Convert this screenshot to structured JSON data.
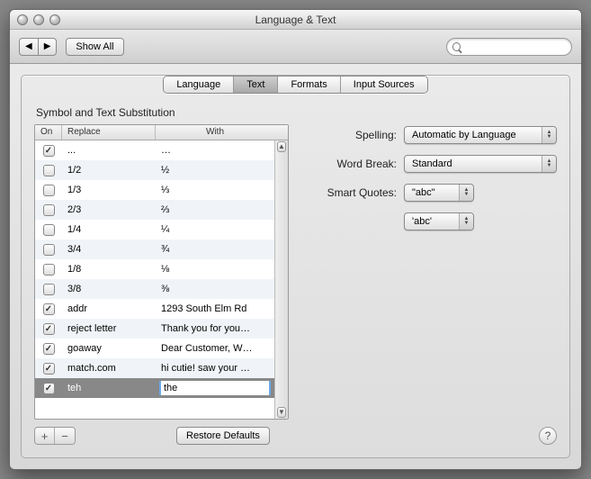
{
  "window": {
    "title": "Language & Text"
  },
  "toolbar": {
    "show_all": "Show All",
    "search_placeholder": ""
  },
  "tabs": {
    "t0": "Language",
    "t1": "Text",
    "t2": "Formats",
    "t3": "Input Sources"
  },
  "section": {
    "title": "Symbol and Text Substitution"
  },
  "table": {
    "headers": {
      "on": "On",
      "replace": "Replace",
      "with": "With"
    },
    "rows": [
      {
        "on": true,
        "replace": "...",
        "with": "…"
      },
      {
        "on": false,
        "replace": "1/2",
        "with": "½"
      },
      {
        "on": false,
        "replace": "1/3",
        "with": "⅓"
      },
      {
        "on": false,
        "replace": "2/3",
        "with": "⅔"
      },
      {
        "on": false,
        "replace": "1/4",
        "with": "¼"
      },
      {
        "on": false,
        "replace": "3/4",
        "with": "¾"
      },
      {
        "on": false,
        "replace": "1/8",
        "with": "⅛"
      },
      {
        "on": false,
        "replace": "3/8",
        "with": "⅜"
      },
      {
        "on": true,
        "replace": "addr",
        "with": "1293 South Elm Rd"
      },
      {
        "on": true,
        "replace": "reject letter",
        "with": "Thank you for you…"
      },
      {
        "on": true,
        "replace": "goaway",
        "with": "Dear Customer, W…"
      },
      {
        "on": true,
        "replace": "match.com",
        "with": "hi cutie! saw your …"
      },
      {
        "on": true,
        "replace": "teh",
        "with": "the",
        "editing": true,
        "selected": true
      }
    ]
  },
  "form": {
    "spelling_label": "Spelling:",
    "spelling_value": "Automatic by Language",
    "wordbreak_label": "Word Break:",
    "wordbreak_value": "Standard",
    "smartquotes_label": "Smart Quotes:",
    "smartquotes_double": "\"abc\"",
    "smartquotes_single": "'abc'"
  },
  "buttons": {
    "restore": "Restore Defaults",
    "add": "+",
    "remove": "−",
    "help": "?"
  }
}
